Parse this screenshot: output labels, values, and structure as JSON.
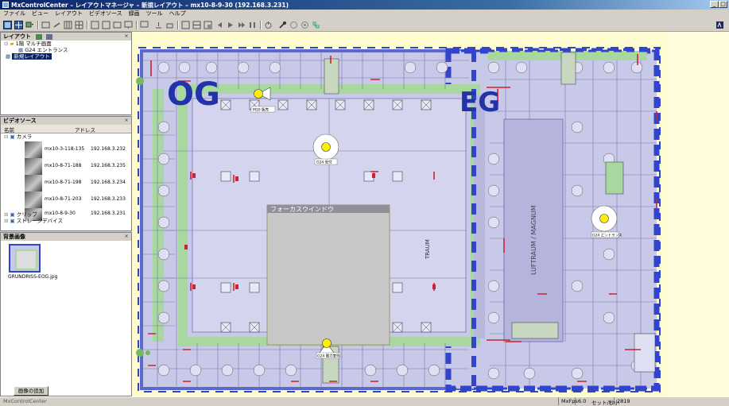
{
  "window": {
    "title": "MxControlCenter – レイアウトマネージャ – 新規レイアウト – mx10-8-9-30 (192.168.3.231)",
    "minimize": "_",
    "maximize": "□"
  },
  "menu": [
    "ファイル",
    "ビュー",
    "レイアウト",
    "ビデオソース",
    "録画",
    "ツール",
    "ヘルプ"
  ],
  "layout_panel": {
    "title": "レイアウト",
    "tree": [
      "1階 マルチ画面",
      "G24 エントランス",
      "新規レイアウト"
    ]
  },
  "video_panel": {
    "title": "ビデオソース",
    "col_name": "名前",
    "col_addr": "アドレス",
    "cameras_label": "カメラ",
    "cameras": [
      {
        "name": "mx10-3-118-135",
        "ip": "192.168.3.232"
      },
      {
        "name": "mx10-8-71-188",
        "ip": "192.168.3.235"
      },
      {
        "name": "mx10-8-71-198",
        "ip": "192.168.3.234"
      },
      {
        "name": "mx10-8-71-203",
        "ip": "192.168.3.233"
      },
      {
        "name": "mx10-8-9-30",
        "ip": "192.168.3.231"
      }
    ],
    "clips_label": "クリップ",
    "storage_label": "ストレージデバイス"
  },
  "bg_panel": {
    "title": "背景画像",
    "file": "GRUNDRISS-EOG.jpg",
    "add_button": "画像の追加"
  },
  "map": {
    "label_left": "OG",
    "label_right": "EG",
    "center_label": "フォーカスウインドウ",
    "vertical_labels": [
      "TRAUM",
      "LUFTRAUM / MAGNUM"
    ],
    "camera_tags": [
      "M10 販売",
      "G24 受付",
      "G24 電力室残",
      "G24 エントランス"
    ],
    "colors": {
      "floor": "#c8c8e8",
      "corridor": "#a8d8a0",
      "border": "#3344cc",
      "walls": "#cc2233",
      "camera": "#ffee00"
    }
  },
  "status": {
    "app": "MxControlCenter",
    "fps_label": "MxFps",
    "fps": "6.0",
    "unit": "セット/秒小",
    "count": "2819"
  }
}
